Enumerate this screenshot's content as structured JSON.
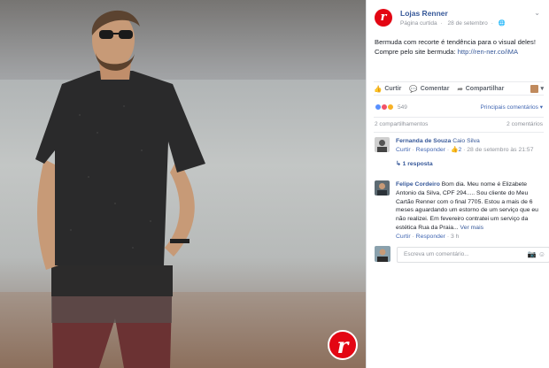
{
  "photo": {
    "brand_logo": "r"
  },
  "post": {
    "page_name": "Lojas Renner",
    "page_logo": "r",
    "page_kind": "Página curtida",
    "date": "28 de setembro",
    "audience_icon": "globe-icon",
    "text": "Bermuda com recorte é tendência para o visual deles! Compre pelo site bermuda: ",
    "link": "http://ren-ner.co/iMA"
  },
  "actions": {
    "like": "Curtir",
    "comment": "Comentar",
    "share": "Compartilhar"
  },
  "reactions": {
    "count": "549",
    "sort_label": "Principais comentários"
  },
  "shares": {
    "shares_label": "2 compartilhamentos",
    "comments_label": "2 comentários"
  },
  "comments": [
    {
      "author": "Fernanda de Souza",
      "tagged": "Caio Silva",
      "like_label": "Curtir",
      "reply_label": "Responder",
      "likes": "2",
      "date": "28 de setembro às 21:57",
      "replies": "1 resposta"
    },
    {
      "author": "Felipe Cordeiro",
      "text": "Bom dia. Meu nome é Elizabete Antonio da Silva, CPF 294..... Sou cliente do Meu Cartão Renner com o final 7705. Estou a mais de 6 meses aguardando um estorno de um serviço que eu não realizei. Em fevereiro contratei um serviço da estética Rua da Praia...",
      "see_more": "Ver mais",
      "like_label": "Curtir",
      "reply_label": "Responder",
      "time": "3 h"
    }
  ],
  "composer": {
    "placeholder": "Escreva um comentário..."
  }
}
